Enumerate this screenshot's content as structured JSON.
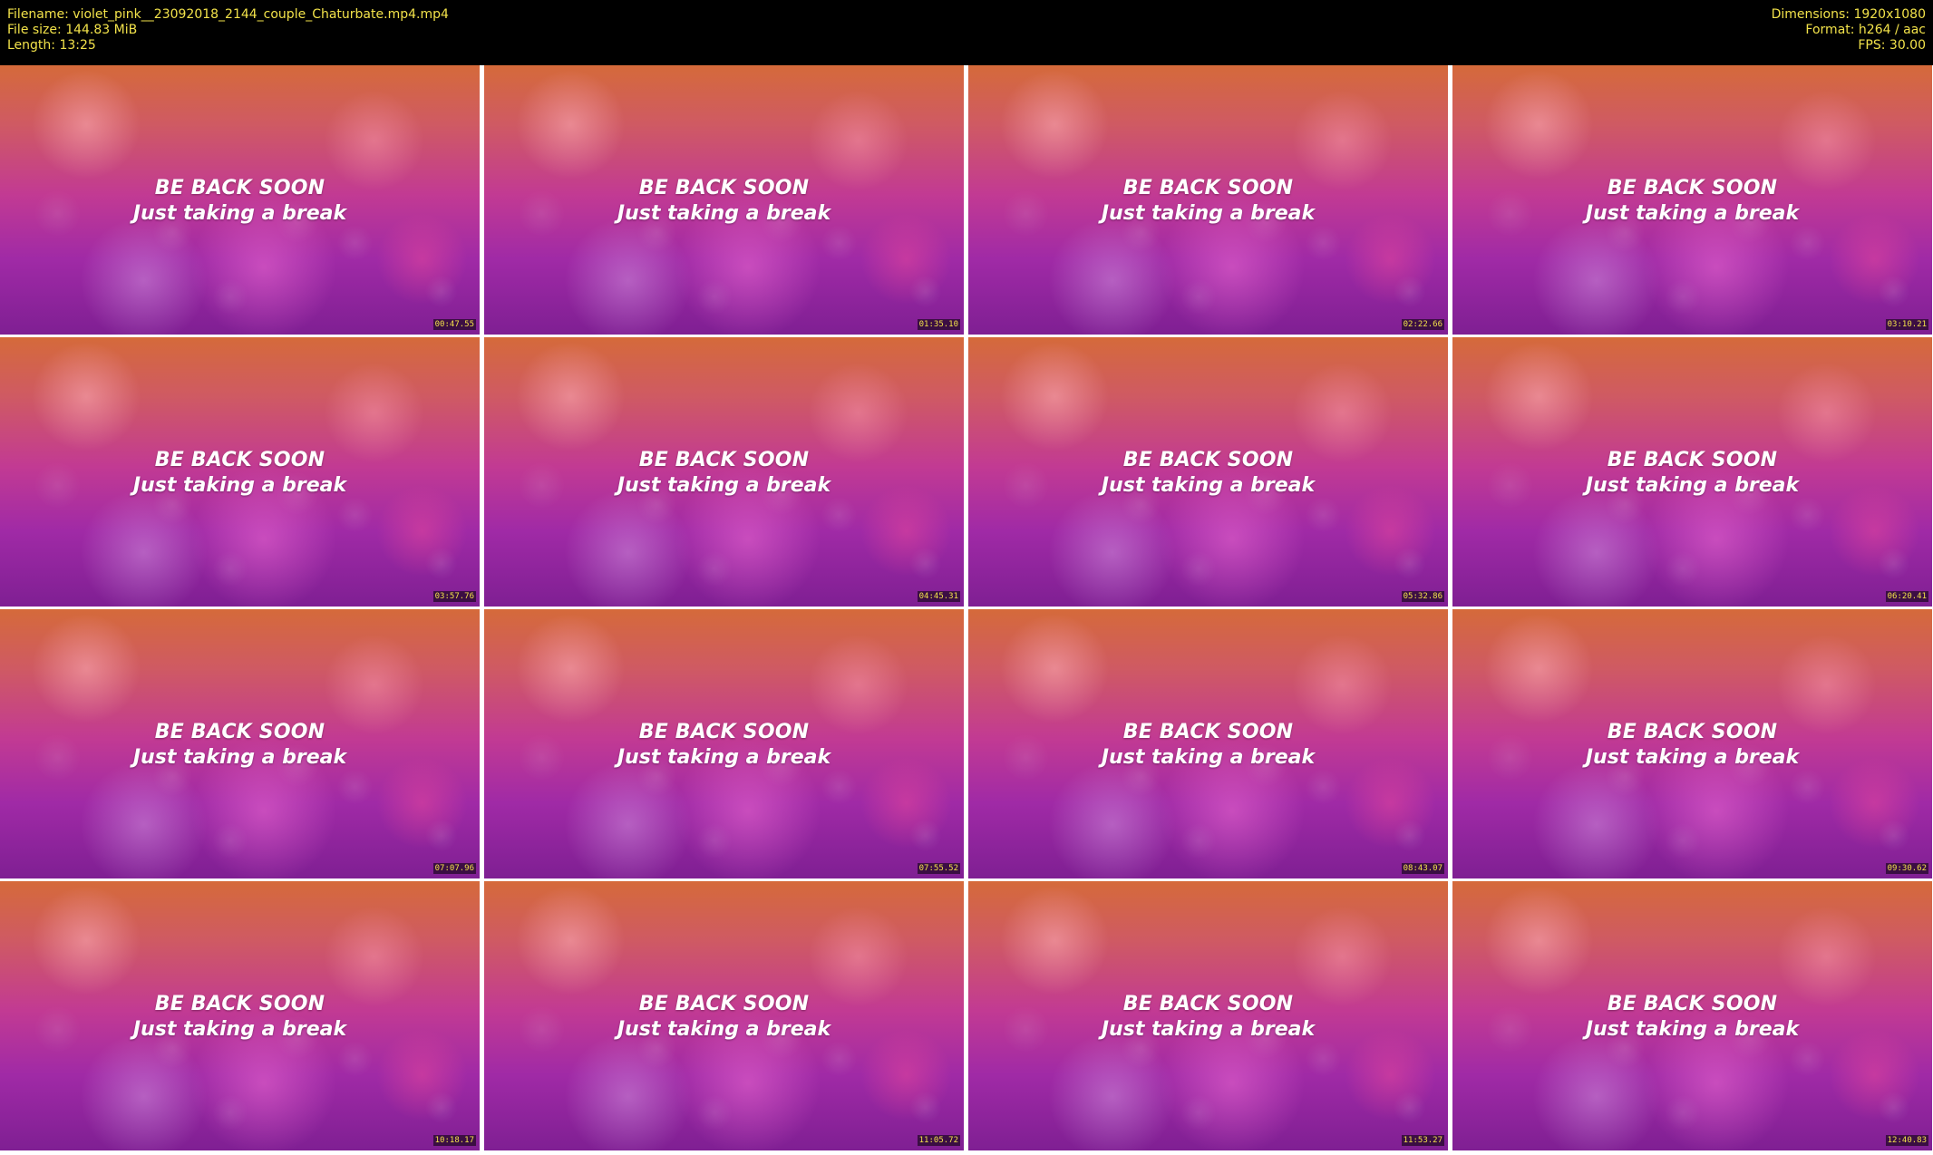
{
  "header": {
    "left": [
      "Filename: violet_pink__23092018_2144_couple_Chaturbate.mp4.mp4",
      "File size: 144.83 MiB",
      "Length: 13:25"
    ],
    "right": [
      "Dimensions: 1920x1080",
      "Format: h264 / aac",
      "FPS: 30.00"
    ]
  },
  "overlay": {
    "line1": "BE BACK SOON",
    "line2": "Just taking a break"
  },
  "thumbnails": [
    {
      "timestamp": "00:47.55"
    },
    {
      "timestamp": "01:35.10"
    },
    {
      "timestamp": "02:22.66"
    },
    {
      "timestamp": "03:10.21"
    },
    {
      "timestamp": "03:57.76"
    },
    {
      "timestamp": "04:45.31"
    },
    {
      "timestamp": "05:32.86"
    },
    {
      "timestamp": "06:20.41"
    },
    {
      "timestamp": "07:07.96"
    },
    {
      "timestamp": "07:55.52"
    },
    {
      "timestamp": "08:43.07"
    },
    {
      "timestamp": "09:30.62"
    },
    {
      "timestamp": "10:18.17"
    },
    {
      "timestamp": "11:05.72"
    },
    {
      "timestamp": "11:53.27"
    },
    {
      "timestamp": "12:40.83"
    }
  ]
}
